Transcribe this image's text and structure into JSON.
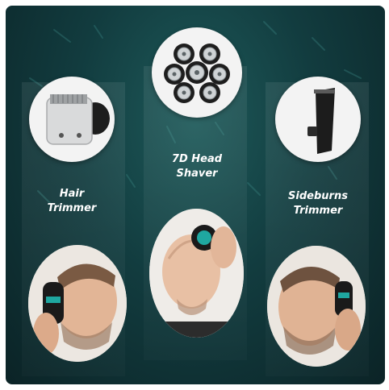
{
  "panels": [
    {
      "label_line1": "Hair",
      "label_line2": "Trimmer"
    },
    {
      "label_line1": "7D Head",
      "label_line2": "Shaver"
    },
    {
      "label_line1": "Sideburns",
      "label_line2": "Trimmer"
    }
  ],
  "colors": {
    "background_dark": "#0b2326",
    "background_teal": "#1e5a5a",
    "accent_teal": "#1fa7a0"
  }
}
